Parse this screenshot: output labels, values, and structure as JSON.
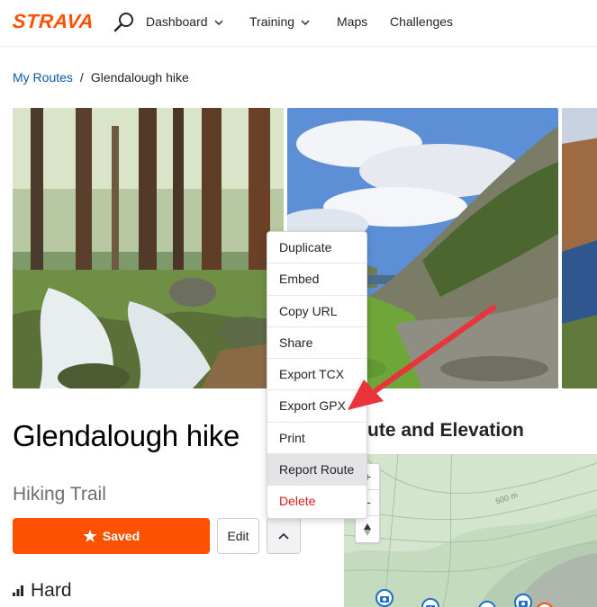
{
  "nav": {
    "logo": "STRAVA",
    "items": [
      {
        "label": "Dashboard",
        "dropdown": true
      },
      {
        "label": "Training",
        "dropdown": true
      },
      {
        "label": "Maps",
        "dropdown": false
      },
      {
        "label": "Challenges",
        "dropdown": false
      }
    ]
  },
  "breadcrumb": {
    "parent": "My Routes",
    "separator": "/",
    "current": "Glendalough hike"
  },
  "route": {
    "title": "Glendalough hike",
    "type": "Hiking Trail",
    "saved_label": "Saved",
    "edit_label": "Edit",
    "difficulty": "Hard"
  },
  "section": {
    "title": "Route and Elevation"
  },
  "map": {
    "contour_label": "500 m",
    "zoom_in": "+",
    "zoom_out": "−"
  },
  "menu": {
    "items": [
      {
        "label": "Duplicate"
      },
      {
        "label": "Embed"
      },
      {
        "label": "Copy URL"
      },
      {
        "label": "Share"
      },
      {
        "label": "Export TCX"
      },
      {
        "label": "Export GPX"
      },
      {
        "label": "Print"
      },
      {
        "label": "Report Route",
        "state": "hover"
      },
      {
        "label": "Delete",
        "style": "danger"
      }
    ]
  },
  "colors": {
    "brand": "#fc5200",
    "link": "#0a5aa6",
    "danger": "#d61e1e",
    "annotation": "#e8343a"
  },
  "icons": {
    "search": "search-icon",
    "chevron": "chevron-down-icon",
    "star": "star-icon",
    "caret_up": "chevron-up-icon",
    "difficulty": "signal-bars-icon",
    "camera": "camera-icon"
  }
}
